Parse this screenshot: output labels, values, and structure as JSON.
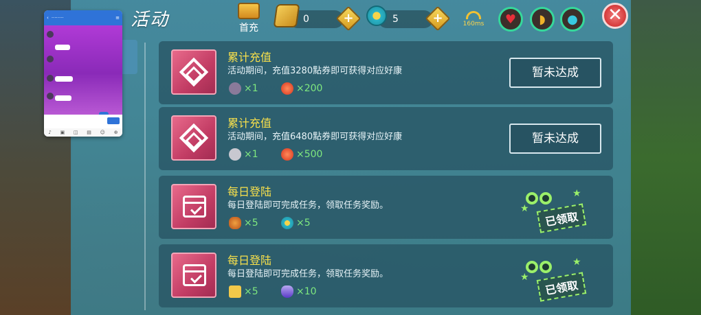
{
  "header": {
    "title": "活动",
    "first_charge_label": "首充",
    "gold_value": "0",
    "gem_value": "5",
    "ping": "160ms"
  },
  "tasks": [
    {
      "title": "累计充值",
      "desc": "活动期间，充值3280點券即可获得对应好康",
      "icon": "diamond",
      "rewards": [
        {
          "icon": "mount-icon",
          "qty": "×1"
        },
        {
          "icon": "red-orb-icon",
          "qty": "×200"
        }
      ],
      "status": "pending",
      "button_label": "暂未达成"
    },
    {
      "title": "累计充值",
      "desc": "活动期间，充值6480點券即可获得对应好康",
      "icon": "diamond",
      "rewards": [
        {
          "icon": "mech-icon",
          "qty": "×1"
        },
        {
          "icon": "red-orb-icon",
          "qty": "×500"
        }
      ],
      "status": "pending",
      "button_label": "暂未达成"
    },
    {
      "title": "每日登陆",
      "desc": "每日登陆即可完成任务，领取任务奖励。",
      "icon": "calendar",
      "rewards": [
        {
          "icon": "food-icon",
          "qty": "×5"
        },
        {
          "icon": "gem-icon",
          "qty": "×5"
        }
      ],
      "status": "claimed",
      "button_label": "已领取"
    },
    {
      "title": "每日登陆",
      "desc": "每日登陆即可完成任务，领取任务奖励。",
      "icon": "calendar",
      "rewards": [
        {
          "icon": "shirt-icon",
          "qty": "×5"
        },
        {
          "icon": "potion-icon",
          "qty": "×10"
        }
      ],
      "status": "claimed",
      "button_label": "已领取"
    }
  ],
  "colors": {
    "title_yellow": "#f8e04b",
    "qty_green": "#7fe87f",
    "panel_teal": "#468ca0",
    "stamp_green": "#9bf06a"
  }
}
